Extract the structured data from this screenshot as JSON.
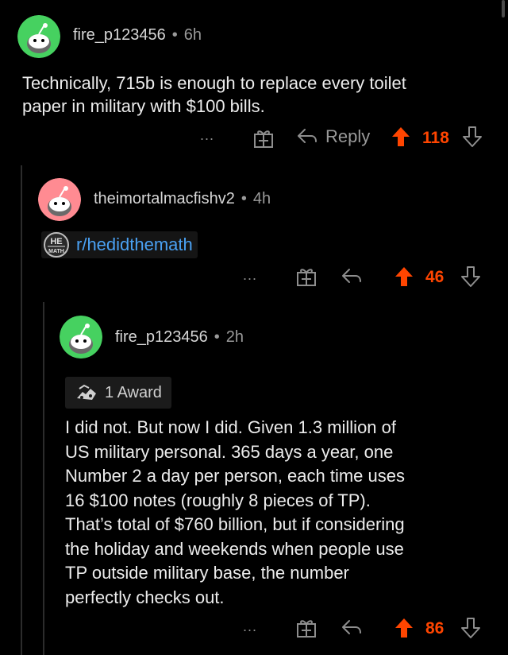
{
  "comments": [
    {
      "username": "fire_p123456",
      "age": "6h",
      "text_lines": [
        "Technically, 715b is enough to replace every toilet",
        "paper in military with $100 bills."
      ],
      "reply_label": "Reply",
      "score": "118",
      "more": "..."
    },
    {
      "username": "theimortalmacfishv2",
      "age": "4h",
      "subreddit_link": "r/hedidthemath",
      "score": "46",
      "more": "..."
    },
    {
      "username": "fire_p123456",
      "age": "2h",
      "award_label": "1 Award",
      "text_lines": [
        "I did not. But now I did. Given 1.3 million of",
        "US military personal. 365 days a year, one",
        "Number 2 a day per person, each time uses",
        "16 $100 notes (roughly 8 pieces of TP).",
        "That’s total of $760 billion, but if considering",
        "the holiday and weekends when people use",
        "TP outside military base, the number",
        "perfectly checks out."
      ],
      "score": "86",
      "more": "..."
    }
  ],
  "colors": {
    "background": "#000000",
    "upvote_active": "#ff4500",
    "link": "#4aa1f3",
    "avatar_green": "#46d160",
    "avatar_pink": "#ff8b92"
  },
  "icons": [
    "snoo-avatar-icon",
    "gift-award-icon",
    "reply-arrow-icon",
    "upvote-arrow-icon",
    "downvote-arrow-icon",
    "more-dots-icon",
    "award-icon",
    "he-did-the-math-icon"
  ]
}
